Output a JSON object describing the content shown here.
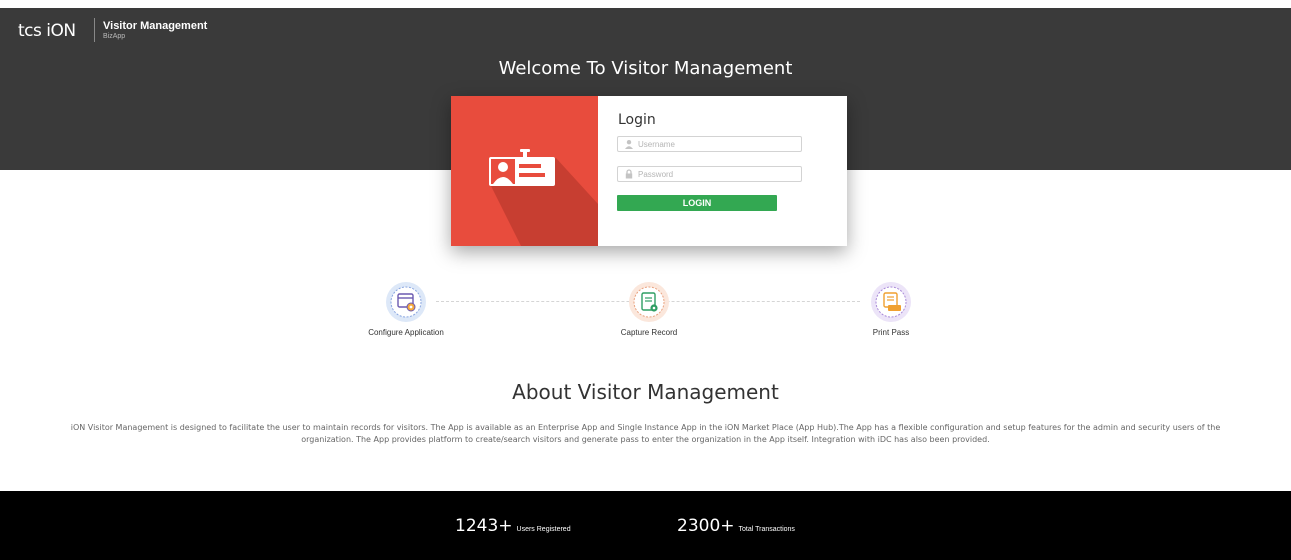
{
  "header": {
    "brand": "tcs iON",
    "app_title": "Visitor Management",
    "app_subtitle": "BizApp"
  },
  "hero": {
    "welcome": "Welcome To Visitor Management"
  },
  "login": {
    "title": "Login",
    "username_placeholder": "Username",
    "password_placeholder": "Password",
    "button_label": "LOGIN"
  },
  "steps": [
    {
      "label": "Configure Application",
      "icon": "configure-app-icon"
    },
    {
      "label": "Capture Record",
      "icon": "capture-record-icon"
    },
    {
      "label": "Print Pass",
      "icon": "print-pass-icon"
    }
  ],
  "about": {
    "title": "About Visitor Management",
    "text": "iON Visitor Management is designed to facilitate the user to maintain records for visitors. The App is available as an Enterprise App and Single Instance App in the iON Market Place (App Hub).The App has a flexible configuration and setup features for the admin and security users of the organization. The App provides platform to create/search visitors and generate pass to enter the organization in the App itself. Integration with iDC has also been provided."
  },
  "stats": [
    {
      "value": "1243+",
      "label": "Users Registered"
    },
    {
      "value": "2300+",
      "label": "Total Transactions"
    }
  ],
  "colors": {
    "hero_bg": "#3a3a3a",
    "login_accent": "#e84c3d",
    "login_button": "#33a852",
    "footer_bg": "#000000"
  }
}
